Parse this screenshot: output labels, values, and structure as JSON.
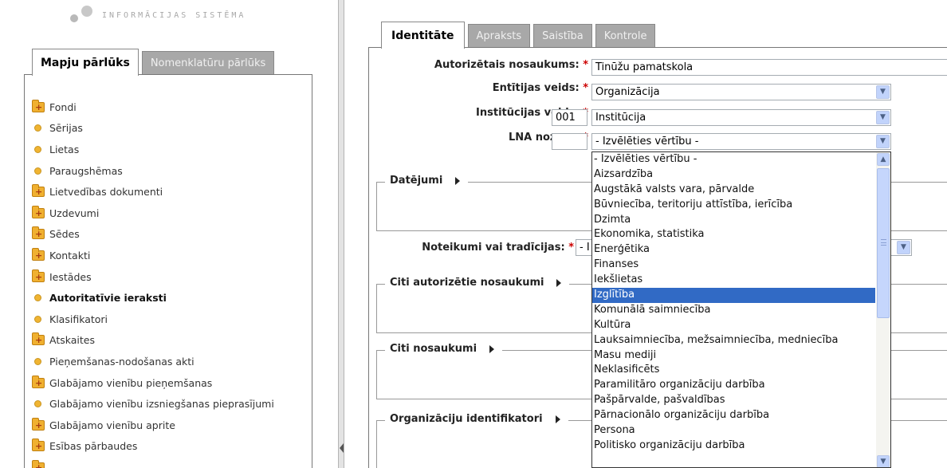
{
  "logo": {
    "text": "INFORMĀCIJAS SISTĒMA"
  },
  "left_tabs": [
    {
      "label": "Mapju pārlūks",
      "active": true
    },
    {
      "label": "Nomenklatūru pārlūks",
      "active": false
    }
  ],
  "tree": [
    {
      "label": "Fondi",
      "icon": "folder-plus-icon"
    },
    {
      "label": "Sērijas",
      "icon": "bullet-icon"
    },
    {
      "label": "Lietas",
      "icon": "bullet-icon"
    },
    {
      "label": "Paraugshēmas",
      "icon": "bullet-icon"
    },
    {
      "label": "Lietvedības dokumenti",
      "icon": "folder-plus-icon"
    },
    {
      "label": "Uzdevumi",
      "icon": "folder-plus-icon"
    },
    {
      "label": "Sēdes",
      "icon": "folder-plus-icon"
    },
    {
      "label": "Kontakti",
      "icon": "folder-plus-icon"
    },
    {
      "label": "Iestādes",
      "icon": "folder-plus-icon"
    },
    {
      "label": "Autoritatīvie ieraksti",
      "icon": "bullet-icon",
      "bold": true
    },
    {
      "label": "Klasifikatori",
      "icon": "bullet-icon"
    },
    {
      "label": "Atskaites",
      "icon": "folder-plus-icon"
    },
    {
      "label": "Pieņemšanas-nodošanas akti",
      "icon": "bullet-icon"
    },
    {
      "label": "Glabājamo vienību pieņemšanas",
      "icon": "folder-plus-icon"
    },
    {
      "label": "Glabājamo vienību izsniegšanas pieprasījumi",
      "icon": "bullet-icon"
    },
    {
      "label": "Glabājamo vienību aprite",
      "icon": "folder-plus-icon"
    },
    {
      "label": "Esības pārbaudes",
      "icon": "folder-plus-icon"
    },
    {
      "label": "",
      "icon": "folder-plus-icon"
    }
  ],
  "right_tabs": [
    {
      "label": "Identitāte",
      "active": true
    },
    {
      "label": "Apraksts",
      "active": false
    },
    {
      "label": "Saistība",
      "active": false
    },
    {
      "label": "Kontrole",
      "active": false
    }
  ],
  "form": {
    "authorized_name": {
      "label": "Autorizētais nosaukums:",
      "value": "Tinūžu pamatskola"
    },
    "entity_type": {
      "label": "Entītijas veids:",
      "value": "Organizācija"
    },
    "institution_type": {
      "label": "Institūcijas veids:",
      "code": "001",
      "value": "Institūcija"
    },
    "lna_sector": {
      "label": "LNA nozare:",
      "code": "",
      "value": "- Izvēlēties vērtību -"
    },
    "rules": {
      "label": "Noteikumi vai tradīcijas:",
      "value": "- I"
    },
    "required_mark": "*"
  },
  "sections": {
    "datejumi": "Datējumi",
    "citi_autorizetie": "Citi autorizētie nosaukumi",
    "citi_nosaukumi": "Citi nosaukumi",
    "org_identifikatori": "Organizāciju identifikatori"
  },
  "dropdown_options": [
    "- Izvēlēties vērtību -",
    "Aizsardzība",
    "Augstākā valsts vara, pārvalde",
    "Būvniecība, teritoriju attīstība, ierīcība",
    "Dzimta",
    "Ekonomika, statistika",
    "Enerģētika",
    "Finanses",
    "Iekšlietas",
    "Izglītība",
    "Komunālā saimniecība",
    "Kultūra",
    "Lauksaimniecība, mežsaimniecība, medniecība",
    "Masu mediji",
    "Neklasificēts",
    "Paramilitāro organizāciju darbība",
    "Pašpārvalde, pašvaldības",
    "Pārnacionālo organizāciju darbība",
    "Persona",
    "Politisko organizāciju darbība"
  ],
  "dropdown_selected": "Izglītība",
  "colors": {
    "selection": "#316ac5",
    "required": "#cc0000",
    "inactive_tab": "#a8a8a8",
    "folder": "#f0b030"
  }
}
